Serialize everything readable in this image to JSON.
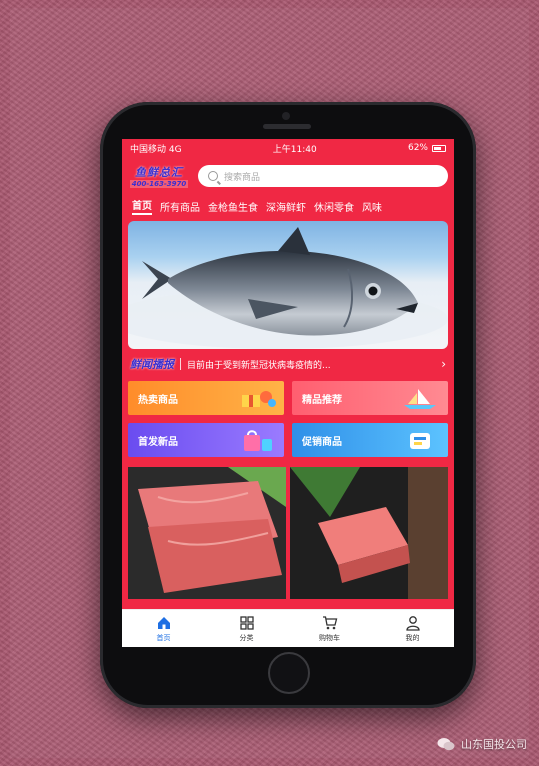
{
  "status_bar": {
    "carrier": "中国移动 4G",
    "time": "上午11:40",
    "battery": "62%"
  },
  "header": {
    "logo_line1": "鱼鲜总汇",
    "logo_line2": "400-163-3970",
    "search_placeholder": "搜索商品"
  },
  "nav": {
    "tabs": [
      "首页",
      "所有商品",
      "金枪鱼生食",
      "深海鲜虾",
      "休闲零食",
      "风味"
    ],
    "active_index": 0
  },
  "news": {
    "logo": "鲜闻播报",
    "text": "目前由于受到新型冠状病毒疫情的..."
  },
  "categories": [
    {
      "label": "热卖商品",
      "color": "#ff9a2e"
    },
    {
      "label": "精品推荐",
      "color": "#ff6e7a"
    },
    {
      "label": "首发新品",
      "color": "#7b5cf0"
    },
    {
      "label": "促销商品",
      "color": "#3ba2ef"
    }
  ],
  "tabbar": {
    "items": [
      {
        "label": "首页",
        "icon": "home-icon",
        "active": true
      },
      {
        "label": "分类",
        "icon": "grid-icon",
        "active": false
      },
      {
        "label": "购物车",
        "icon": "cart-icon",
        "active": false
      },
      {
        "label": "我的",
        "icon": "user-icon",
        "active": false
      }
    ]
  },
  "watermark": {
    "text": "山东国投公司"
  },
  "colors": {
    "brand_red": "#f02844",
    "tab_active": "#1e6fe3",
    "background": "#a9576f"
  }
}
